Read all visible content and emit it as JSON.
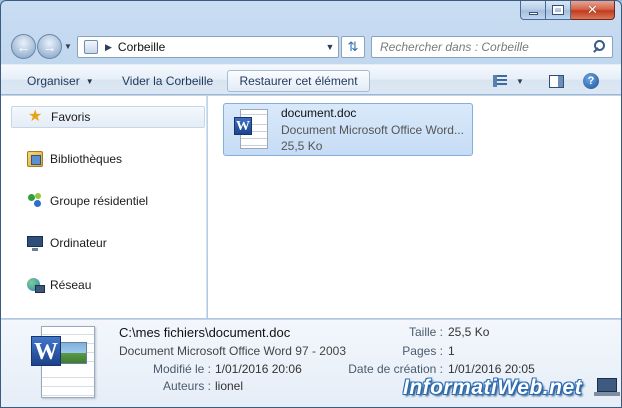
{
  "window": {
    "caption": {
      "minimize": "minimize",
      "maximize": "maximize",
      "close": "✕"
    }
  },
  "navbar": {
    "address": "Corbeille",
    "search_placeholder": "Rechercher dans : Corbeille"
  },
  "toolbar": {
    "organize": "Organiser",
    "empty_recycle_bin": "Vider la Corbeille",
    "restore_item": "Restaurer cet élément",
    "help": "?"
  },
  "sidebar": {
    "items": [
      {
        "label": "Favoris",
        "icon": "star-icon"
      },
      {
        "label": "Bibliothèques",
        "icon": "library-icon"
      },
      {
        "label": "Groupe résidentiel",
        "icon": "homegroup-icon"
      },
      {
        "label": "Ordinateur",
        "icon": "computer-icon"
      },
      {
        "label": "Réseau",
        "icon": "network-icon"
      }
    ]
  },
  "file": {
    "name": "document.doc",
    "type": "Document Microsoft Office Word...",
    "size": "25,5 Ko"
  },
  "details": {
    "path": "C:\\mes fichiers\\document.doc",
    "type": "Document Microsoft Office Word 97 - 2003",
    "modified_label": "Modifié le :",
    "modified_value": "1/01/2016 20:06",
    "authors_label": "Auteurs :",
    "authors_value": "lionel",
    "size_label": "Taille :",
    "size_value": "25,5 Ko",
    "pages_label": "Pages :",
    "pages_value": "1",
    "created_label": "Date de création :",
    "created_value": "1/01/2016 20:05",
    "watermark": "InformatiWeb.net"
  },
  "colors": {
    "selection": "#c6dcf5",
    "window_frame": "#b5cfe9",
    "link": "#1e395b"
  }
}
